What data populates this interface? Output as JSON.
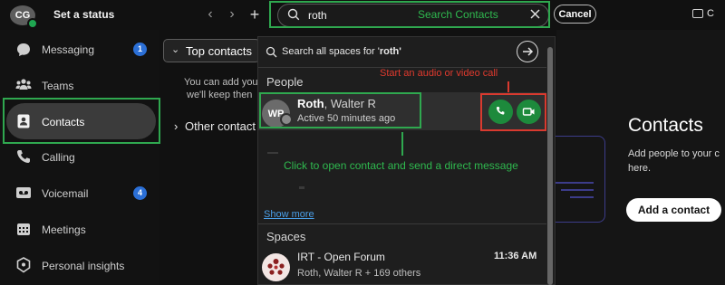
{
  "topbar": {
    "avatar_initials": "CG",
    "set_status": "Set a status",
    "back_icon": "‹",
    "forward_icon": "›",
    "add_icon": "+",
    "search_value": "roth",
    "cancel_label": "Cancel",
    "right_label": "C"
  },
  "annotations": {
    "search": "Search Contacts",
    "call": "Start an audio or video call",
    "message": "Click to open contact and send a direct message",
    "highlight_green": "#2fa84f",
    "highlight_red": "#d93a2f"
  },
  "sidebar": {
    "items": [
      {
        "label": "Messaging",
        "icon": "chat-bubble-icon",
        "badge": "1"
      },
      {
        "label": "Teams",
        "icon": "people-group-icon"
      },
      {
        "label": "Contacts",
        "icon": "contact-card-icon",
        "active": true
      },
      {
        "label": "Calling",
        "icon": "phone-icon"
      },
      {
        "label": "Voicemail",
        "icon": "voicemail-icon",
        "badge": "4"
      },
      {
        "label": "Meetings",
        "icon": "calendar-icon"
      },
      {
        "label": "Personal insights",
        "icon": "insights-icon"
      }
    ]
  },
  "middle": {
    "top_contacts": "Top contacts",
    "text1": "You can add you",
    "text2": "we'll keep then",
    "other_contacts": "Other contact"
  },
  "dropdown": {
    "search_all_prefix": "Search all spaces for '",
    "search_all_term": "roth",
    "search_all_suffix": "'",
    "people_heading": "People",
    "person": {
      "initials": "WP",
      "first": "Roth",
      "rest": ", Walter R",
      "status": "Active 50 minutes ago"
    },
    "show_more": "Show more",
    "spaces_heading": "Spaces",
    "space": {
      "name": "IRT - Open Forum",
      "time": "11:36 AM",
      "members": "Roth, Walter R + 169 others"
    }
  },
  "right_panel": {
    "heading": "Contacts",
    "desc1": "Add people to your c",
    "desc2": "here.",
    "add_button": "Add a contact"
  },
  "colors": {
    "accent_green": "#1d8a3c",
    "badge_blue": "#2b6fd6",
    "link_blue": "#4a9fe8"
  }
}
